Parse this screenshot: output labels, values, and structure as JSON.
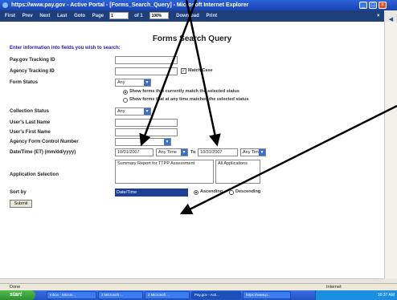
{
  "window": {
    "title": "https://www.pay.gov - Active Portal - [Forms_Search_Query] - Microsoft Internet Explorer"
  },
  "toolbar": {
    "first": "First",
    "prev": "Prev",
    "next": "Next",
    "last": "Last",
    "goto": "Goto",
    "page_label": "Page",
    "page_value": "1",
    "of_label": "of 1",
    "zoom": "100%",
    "download": "Download",
    "print": "Print"
  },
  "form": {
    "title": "Forms Search Query",
    "instructions": "Enter information into fields you wish to search:",
    "tracking_id_label": "Pay.gov Tracking ID",
    "agency_tracking_label": "Agency Tracking ID",
    "match_case_label": "Match Case",
    "form_status_label": "Form Status",
    "form_status_value": "Any",
    "status_option1": "Show forms that currently match the selected status",
    "status_option2": "Show forms that at any time matched the selected status",
    "collection_status_label": "Collection Status",
    "collection_status_value": "Any",
    "last_name_label": "User's Last Name",
    "first_name_label": "User's First Name",
    "control_number_label": "Agency Form Control Number",
    "date_label": "Date/Time (ET) (mm/dd/yyyy)",
    "date_from": "10/01/2007",
    "time_from": "Any Time",
    "to_label": "To",
    "date_to": "10/31/2007",
    "time_to": "Any Time",
    "application_label": "Application Selection",
    "application_list": [
      "Summary Report for TTPP Assessment"
    ],
    "application_list2": [
      "All Applications"
    ],
    "sort_label": "Sort by",
    "sort_value": "Date/Time",
    "ascending_label": "Ascending",
    "descending_label": "Descending",
    "submit_label": "Submit"
  },
  "status": {
    "left": "Done",
    "zone": "Internet"
  },
  "taskbar": {
    "start": "start",
    "tasks": [
      "Inbox - Micros...",
      "2 Microsoft ...",
      "2 Microsoft ...",
      "Pay.gov - Acti...",
      "https://www.p..."
    ],
    "clock": "10:37 AM"
  },
  "colors": {
    "titlebar": "#1743b4",
    "toolbar": "#1f3f7a",
    "accent": "#1c3f98",
    "taskbar": "#2253c4",
    "start": "#2f8f2f"
  }
}
